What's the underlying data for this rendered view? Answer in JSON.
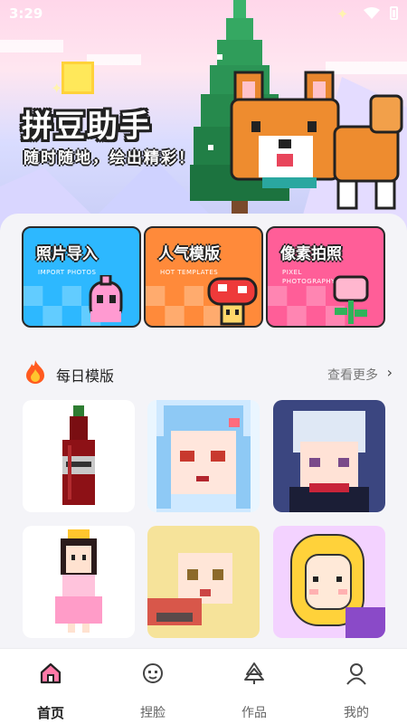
{
  "status": {
    "time": "3:29"
  },
  "hero": {
    "title": "拼豆助手",
    "subtitle": "随时随地，绘出精彩！"
  },
  "features": [
    {
      "title": "照片导入",
      "subtitle": "IMPORT PHOTOS",
      "color": "#2db8ff"
    },
    {
      "title": "人气模版",
      "subtitle": "HOT TEMPLATES",
      "color": "#ff8a3a"
    },
    {
      "title": "像素拍照",
      "subtitle": "PIXEL PHOTOGRAPHY",
      "color": "#ff5e98"
    }
  ],
  "section": {
    "title": "每日模版",
    "more": "查看更多"
  },
  "tabs": [
    {
      "label": "首页",
      "icon": "home-icon"
    },
    {
      "label": "捏脸",
      "icon": "face-icon"
    },
    {
      "label": "作品",
      "icon": "tree-icon"
    },
    {
      "label": "我的",
      "icon": "user-icon"
    }
  ],
  "colors": {
    "accent": "#ff5e98",
    "tabActive": "#222222"
  }
}
